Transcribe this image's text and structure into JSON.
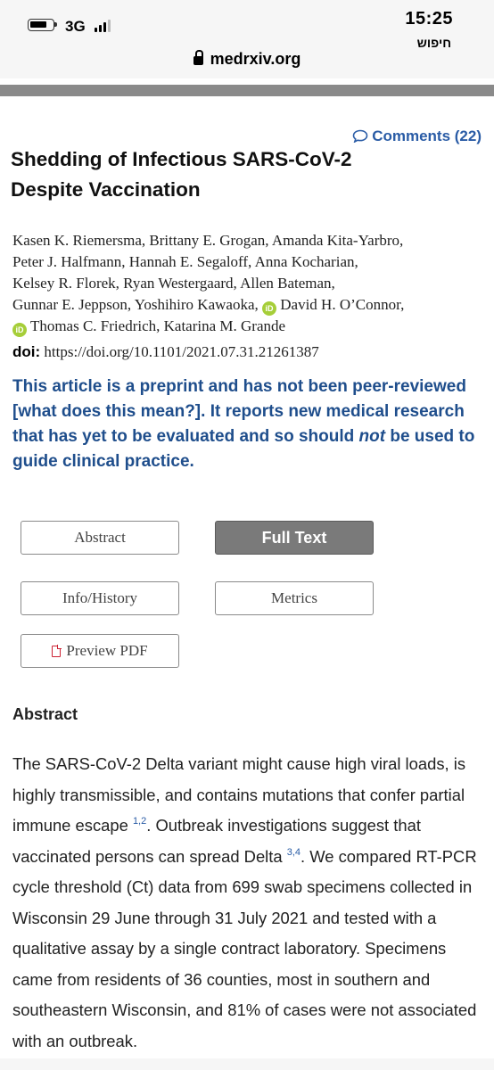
{
  "status_bar": {
    "network": "3G",
    "time": "15:25",
    "search_label": "חיפוש"
  },
  "browser": {
    "url": "medrxiv.org"
  },
  "article": {
    "comments_label": "Comments (22)",
    "title": "Shedding of Infectious SARS-CoV-2 Despite Vaccination",
    "authors_lines": [
      "Kasen K. Riemersma, Brittany E. Grogan, Amanda Kita-Yarbro,",
      "Peter J. Halfmann, Hannah E. Segaloff, Anna Kocharian,",
      "Kelsey R. Florek, Ryan Westergaard, Allen Bateman,",
      "Gunnar E. Jeppson, Yoshihiro Kawaoka,",
      "David H. O’Connor,",
      "Thomas C. Friedrich, Katarina M. Grande"
    ],
    "orcid_glyph": "iD",
    "doi_label": "doi:",
    "doi_url": "https://doi.org/10.1101/2021.07.31.21261387",
    "notice": {
      "part1": "This article is a preprint and has not been peer-reviewed [what does this mean?]. It reports new medical research that has yet to be evaluated and so should ",
      "emphasis": "not",
      "part2": " be used to guide clinical practice."
    },
    "buttons": {
      "abstract": "Abstract",
      "full_text": "Full Text",
      "info_history": "Info/History",
      "metrics": "Metrics",
      "preview_pdf": "Preview PDF"
    },
    "abstract_heading": "Abstract",
    "abstract": {
      "s1": "The SARS-CoV-2 Delta variant might cause high viral loads, is highly transmissible, and contains mutations that confer partial immune escape ",
      "ref1": "1,2",
      "s2": ". Outbreak investigations suggest that vaccinated persons can spread Delta ",
      "ref2": "3,4",
      "s3": ". We compared RT-PCR cycle threshold (Ct) data from 699 swab specimens collected in Wisconsin 29 June through 31 July 2021 and tested with a qualitative assay by a single contract laboratory. Specimens came from residents of 36 counties, most in southern and southeastern Wisconsin, and 81% of cases were not associated with an outbreak."
    }
  }
}
